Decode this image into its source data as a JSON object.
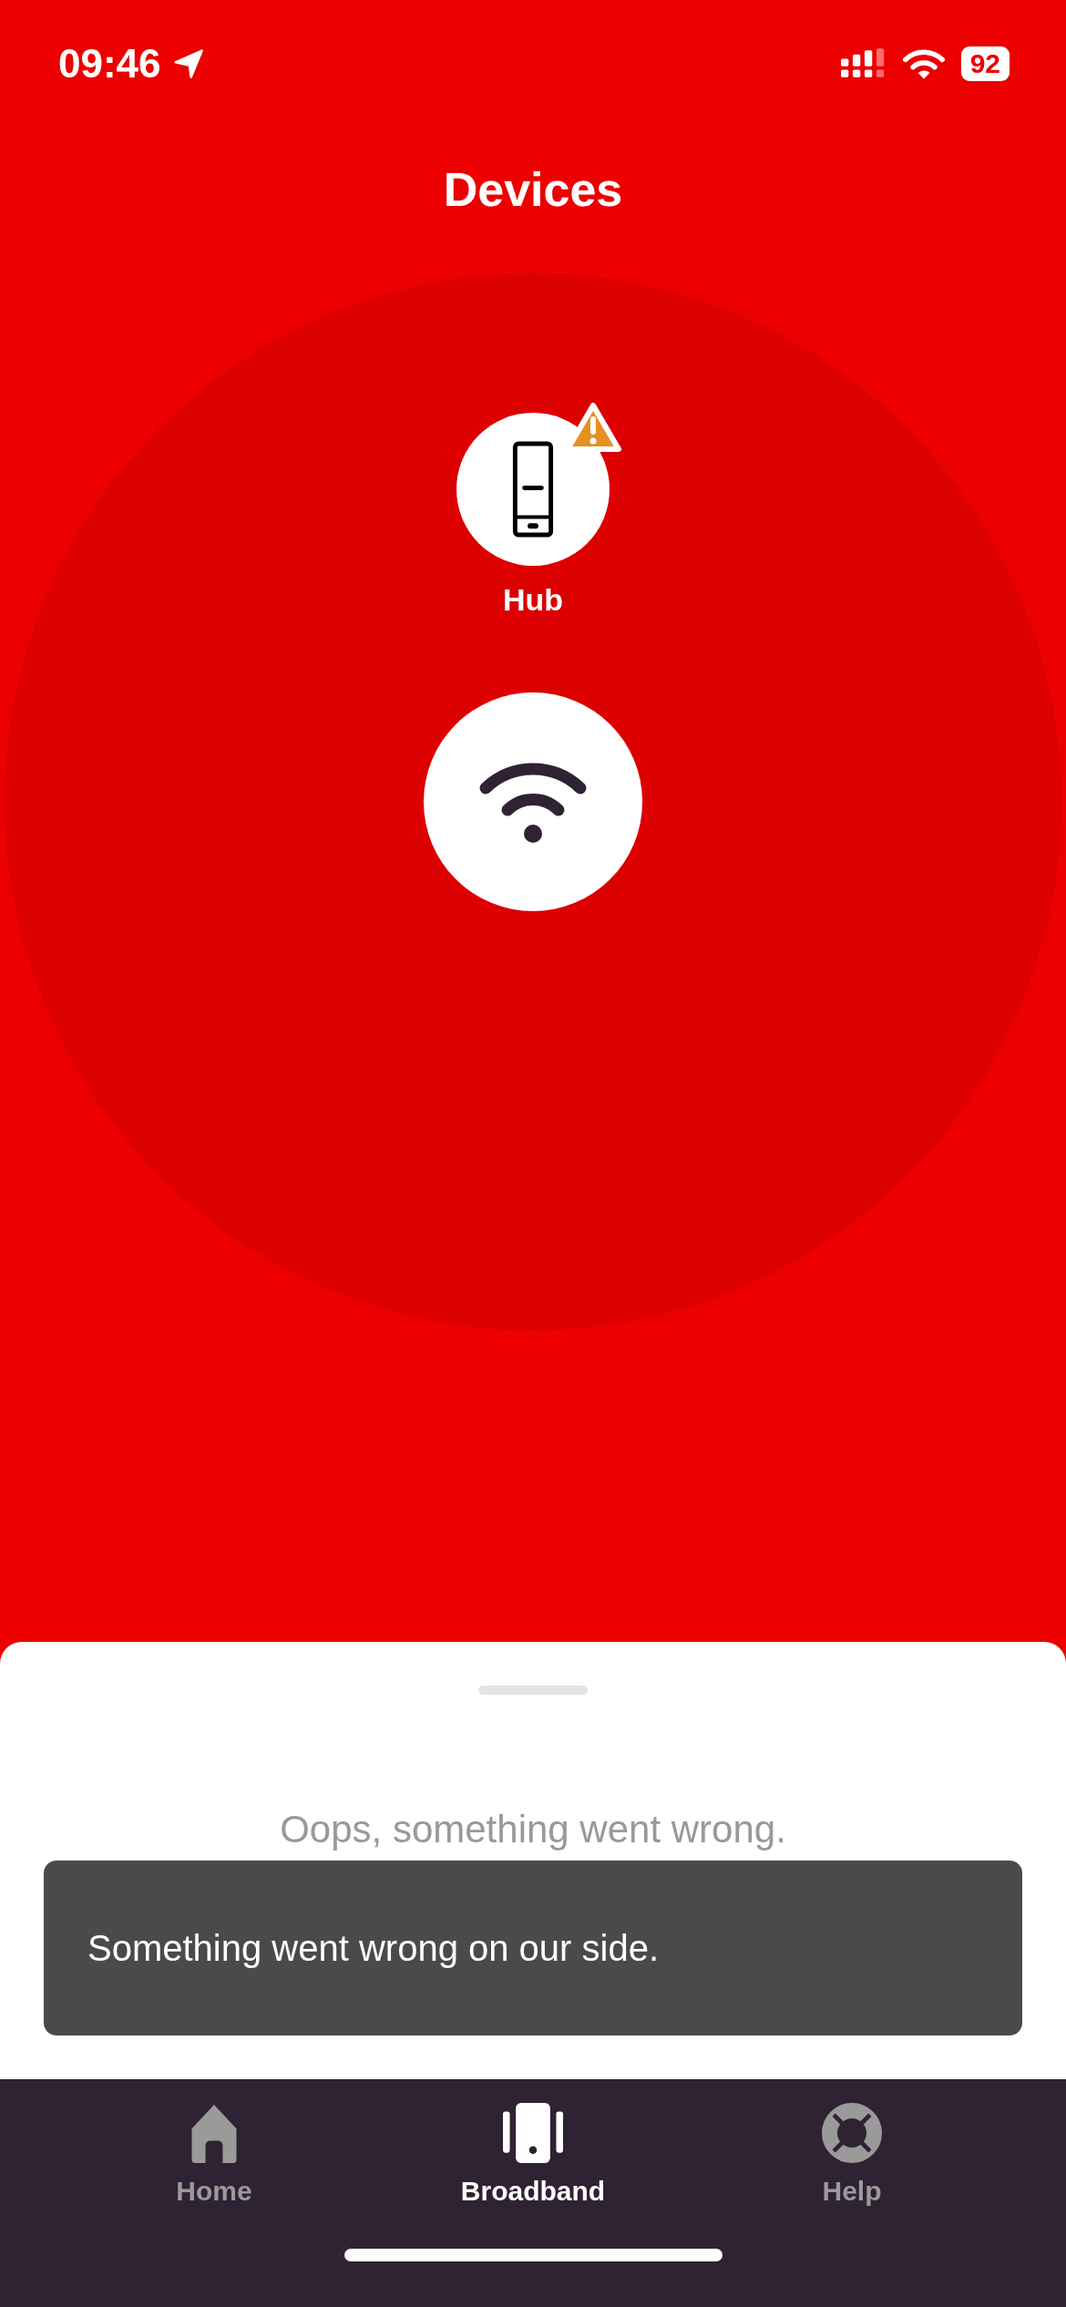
{
  "status_bar": {
    "time": "09:46",
    "battery": "92"
  },
  "title": "Devices",
  "devices": [
    {
      "label": "Hub",
      "warning": true
    }
  ],
  "sheet": {
    "message": "Oops, something went wrong."
  },
  "toast": {
    "text": "Something went wrong on our side."
  },
  "tabs": [
    {
      "label": "Home",
      "kind": "home",
      "selected": false
    },
    {
      "label": "Broadband",
      "kind": "broadband",
      "selected": true
    },
    {
      "label": "Help",
      "kind": "help",
      "selected": false
    }
  ]
}
